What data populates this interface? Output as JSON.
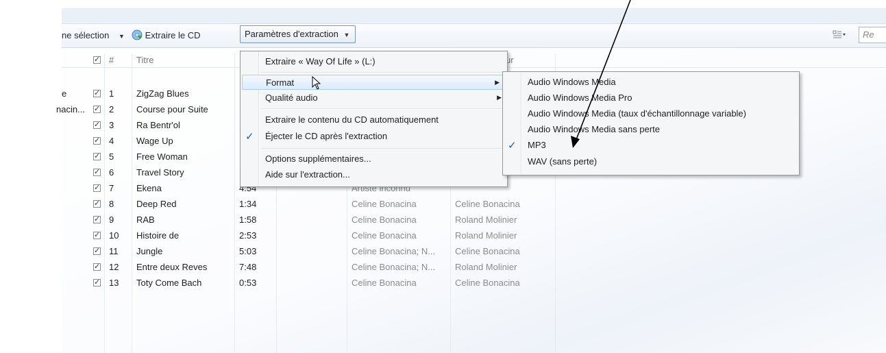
{
  "toolbar": {
    "selection_label": "ne sélection",
    "rip_label": "Extraire le CD",
    "rip_settings_label": "Paramètres d'extraction",
    "search_placeholder": "Re"
  },
  "columns": {
    "check": "☑",
    "number": "#",
    "title": "Titre",
    "composer_partial": "ur"
  },
  "left_clipped": [
    "e",
    "nacin..."
  ],
  "tracks": [
    {
      "n": "1",
      "title": "ZigZag Blues",
      "dur": "",
      "artist": "",
      "composer": ""
    },
    {
      "n": "2",
      "title": "Course pour Suite",
      "dur": "",
      "artist": "",
      "composer": ""
    },
    {
      "n": "3",
      "title": "Ra Bentr'ol",
      "dur": "",
      "artist": "",
      "composer": ""
    },
    {
      "n": "4",
      "title": "Wage Up",
      "dur": "",
      "artist": "",
      "composer": ""
    },
    {
      "n": "5",
      "title": "Free Woman",
      "dur": "",
      "artist": "",
      "composer": ""
    },
    {
      "n": "6",
      "title": "Travel Story",
      "dur": "",
      "artist": "",
      "composer": ""
    },
    {
      "n": "7",
      "title": "Ekena",
      "dur": "4:54",
      "artist": "Artiste inconnu",
      "composer": ""
    },
    {
      "n": "8",
      "title": "Deep Red",
      "dur": "1:34",
      "artist": "Celine Bonacina",
      "composer": "Celine Bonacina"
    },
    {
      "n": "9",
      "title": "RAB",
      "dur": "1:58",
      "artist": "Celine Bonacina",
      "composer": "Roland Molinier"
    },
    {
      "n": "10",
      "title": "Histoire de",
      "dur": "2:53",
      "artist": "Celine Bonacina",
      "composer": "Roland Molinier"
    },
    {
      "n": "11",
      "title": "Jungle",
      "dur": "5:03",
      "artist": "Celine Bonacina; N...",
      "composer": "Celine Bonacina"
    },
    {
      "n": "12",
      "title": "Entre deux Reves",
      "dur": "7:48",
      "artist": "Celine Bonacina; N...",
      "composer": "Roland Molinier"
    },
    {
      "n": "13",
      "title": "Toty Come Bach",
      "dur": "0:53",
      "artist": "Celine Bonacina",
      "composer": "Celine Bonacina"
    }
  ],
  "menu": {
    "rip_drive": "Extraire « Way Of Life » (L:)",
    "format": "Format",
    "audio_quality": "Qualité audio",
    "auto_rip": "Extraire le contenu du CD automatiquement",
    "eject_after": "Éjecter le CD après l'extraction",
    "more_options": "Options supplémentaires...",
    "help": "Aide sur l'extraction..."
  },
  "submenu": {
    "wma": "Audio Windows Media",
    "wma_pro": "Audio Windows Media Pro",
    "wma_vbr": "Audio Windows Media (taux d'échantillonnage variable)",
    "wma_lossless": "Audio Windows Media sans perte",
    "mp3": "MP3",
    "wav": "WAV (sans perte)"
  },
  "colors": {
    "accent": "#1a5fb4",
    "arrow": "#000000",
    "highlight": "#dcebfc"
  },
  "checked": {
    "eject_after": true,
    "format": "MP3"
  }
}
